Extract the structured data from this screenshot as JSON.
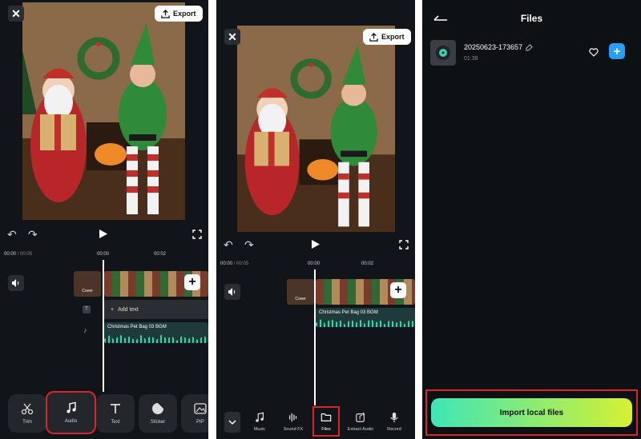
{
  "panel1": {
    "export_label": "Export",
    "time_current": "00:00",
    "time_total": "/ 00:05",
    "tick1": "00:00",
    "tick2": "00:02",
    "cover_label": "Cover",
    "add_text_label": "Add text",
    "audio_track_name": "Christmas Pet Bag 03 BGM",
    "tools": [
      {
        "label": "Trim"
      },
      {
        "label": "Audio"
      },
      {
        "label": "Text"
      },
      {
        "label": "Sticker"
      },
      {
        "label": "PIP"
      }
    ]
  },
  "panel2": {
    "export_label": "Export",
    "time_current": "00:00",
    "time_total": "/ 00:05",
    "tick1": "00:00",
    "tick2": "00:02",
    "cover_label": "Cover",
    "audio_track_name": "Christmas Pet Bag 03 BGM",
    "tools": [
      {
        "label": "Music"
      },
      {
        "label": "Sound FX"
      },
      {
        "label": "Files"
      },
      {
        "label": "Extract Audio"
      },
      {
        "label": "Record"
      }
    ]
  },
  "panel3": {
    "title": "Files",
    "file_name": "20250623-173657",
    "file_duration": "01:38",
    "import_label": "Import local files"
  },
  "colors": {
    "highlight": "#d8262b",
    "accent_blue": "#2a9df4",
    "import_gradient_start": "#3ee6b8",
    "import_gradient_end": "#d6f032"
  }
}
